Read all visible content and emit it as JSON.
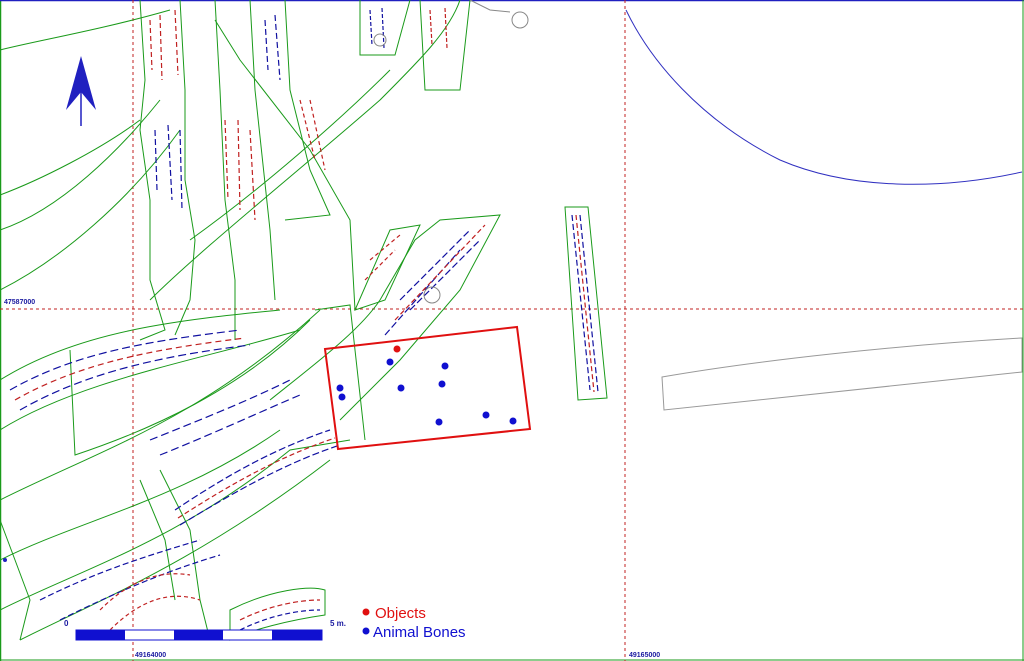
{
  "map": {
    "grid_labels": {
      "north_line": "47587000",
      "east_line_left": "49164000",
      "east_line_right": "49165000"
    },
    "north_arrow_icon": "north-arrow-icon",
    "scale_bar": {
      "start_label": "0",
      "end_label": "5 m."
    },
    "legend": [
      {
        "label": "Objects",
        "color": "#e01010",
        "icon": "red-dot-icon"
      },
      {
        "label": "Animal Bones",
        "color": "#1010d0",
        "icon": "blue-dot-icon"
      }
    ],
    "colors": {
      "trench_outline": "#1a9a1a",
      "grid": "#c02020",
      "highlight_box": "#e01010",
      "contour": "#3030c0",
      "frame_left": "#1a9a1a",
      "frame_top": "#2020c0"
    },
    "finds": {
      "objects_count": 1,
      "animal_bones_count": 9
    }
  }
}
